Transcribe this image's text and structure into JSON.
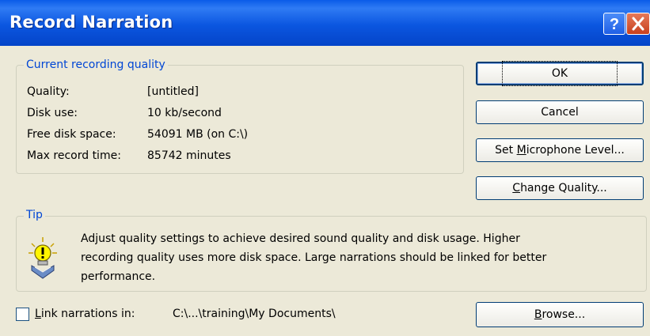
{
  "window": {
    "title": "Record Narration",
    "help_icon": "question-mark-icon",
    "close_icon": "close-x-icon"
  },
  "quality_group": {
    "label": "Current recording quality",
    "rows": [
      {
        "key": "Quality:",
        "value": "[untitled]"
      },
      {
        "key": "Disk use:",
        "value": "10 kb/second"
      },
      {
        "key": "Free disk space:",
        "value": "54091 MB (on C:\\)"
      },
      {
        "key": "Max record time:",
        "value": "85742 minutes"
      }
    ]
  },
  "buttons": {
    "ok": "OK",
    "cancel": "Cancel",
    "mic_pre": "Set ",
    "mic_u": "M",
    "mic_post": "icrophone Level...",
    "quality_u": "C",
    "quality_post": "hange Quality...",
    "browse_u": "B",
    "browse_post": "rowse..."
  },
  "tip_group": {
    "label": "Tip",
    "icon": "lightbulb-tip-icon",
    "line1": "Adjust quality settings to achieve desired sound quality and disk usage. Higher",
    "line2": "recording quality uses more disk space. Large narrations should be linked for better",
    "line3": "performance."
  },
  "link": {
    "checked": false,
    "label_u": "L",
    "label_post": "ink narrations in:",
    "path": "C:\\...\\training\\My Documents\\"
  },
  "colors": {
    "title_bar": "#0a5ce8",
    "group_label": "#0046d5",
    "dialog_bg": "#ece9d8"
  }
}
